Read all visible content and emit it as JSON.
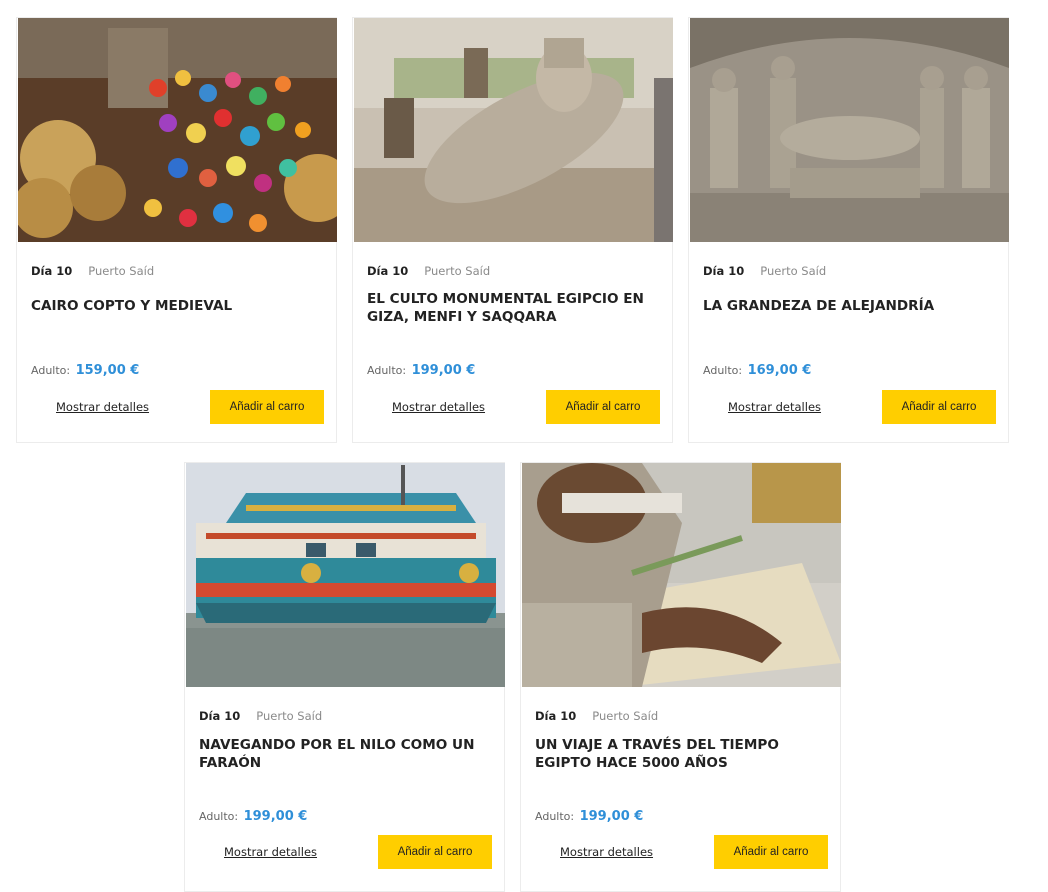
{
  "cards": [
    {
      "day": "Día 10",
      "port": "Puerto Saíd",
      "title": "CAIRO COPTO Y MEDIEVAL",
      "price_label": "Adulto:",
      "price": "159,00 €",
      "details_label": "Mostrar detalles",
      "cart_label": "Añadir al carro",
      "image": "lanterns-bazaar"
    },
    {
      "day": "Día 10",
      "port": "Puerto Saíd",
      "title": "EL CULTO MONUMENTAL EGIPCIO EN GIZA, MENFI Y SAQQARA",
      "price_label": "Adulto:",
      "price": "199,00 €",
      "details_label": "Mostrar detalles",
      "cart_label": "Añadir al carro",
      "image": "ramses-statue"
    },
    {
      "day": "Día 10",
      "port": "Puerto Saíd",
      "title": "LA GRANDEZA DE ALEJANDRÍA",
      "price_label": "Adulto:",
      "price": "169,00 €",
      "details_label": "Mostrar detalles",
      "cart_label": "Añadir al carro",
      "image": "catacomb-relief"
    },
    {
      "day": "Día 10",
      "port": "Puerto Saíd",
      "title": "NAVEGANDO POR EL NILO COMO UN FARAÓN",
      "price_label": "Adulto:",
      "price": "199,00 €",
      "details_label": "Mostrar detalles",
      "cart_label": "Añadir al carro",
      "image": "nile-boat"
    },
    {
      "day": "Día 10",
      "port": "Puerto Saíd",
      "title": "UN VIAJE A TRAVÉS DEL TIEMPO EGIPTO HACE 5000 AÑOS",
      "price_label": "Adulto:",
      "price": "199,00 €",
      "details_label": "Mostrar detalles",
      "cart_label": "Añadir al carro",
      "image": "papyrus-making"
    }
  ],
  "colors": {
    "accent_button": "#ffce00",
    "price": "#2f8fd8",
    "title": "#222222",
    "muted": "#8a8a8a"
  }
}
